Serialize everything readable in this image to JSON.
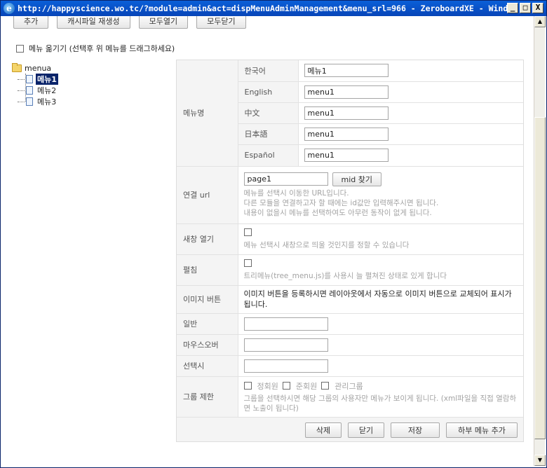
{
  "window": {
    "title": "http://happyscience.wo.tc/?module=admin&act=dispMenuAdminManagement&menu_srl=966 - ZeroboardXE - Windows Internet Explo...",
    "minimize": "_",
    "maximize": "□",
    "close": "X"
  },
  "toolbar": {
    "add": "추가",
    "regen_cache": "캐시파일 재생성",
    "expand_all": "모두열기",
    "collapse_all": "모두닫기"
  },
  "move_menu": {
    "label": "메뉴 옮기기 (선택후 위 메뉴를 드래그하세요)"
  },
  "tree": {
    "root": "menua",
    "items": [
      "메뉴1",
      "메뉴2",
      "메뉴3"
    ]
  },
  "form": {
    "menu_name": {
      "label": "메뉴명",
      "langs": [
        {
          "lang": "한국어",
          "value": "메뉴1"
        },
        {
          "lang": "English",
          "value": "menu1"
        },
        {
          "lang": "中文",
          "value": "menu1"
        },
        {
          "lang": "日本語",
          "value": "menu1"
        },
        {
          "lang": "Español",
          "value": "menu1"
        }
      ]
    },
    "url": {
      "label": "연결 url",
      "value": "page1",
      "mid_button": "mid 찾기",
      "desc1": "메뉴를 선택시 이동한 URL입니다.",
      "desc2": "다른 모듈을 연결하고자 할 때에는 id값만 입력해주시면 됩니다.",
      "desc3": "내용이 없을시 메뉴를 선택하여도 아무런 동작이 없게 됩니다."
    },
    "new_window": {
      "label": "새창 열기",
      "desc": "메뉴 선택시 새창으로 띄울 것인지를 정할 수 있습니다"
    },
    "expand": {
      "label": "펼침",
      "desc": "트리메뉴(tree_menu.js)를 사용시 늘 펼쳐진 상태로 있게 합니다"
    },
    "image_button": {
      "label": "이미지 버튼",
      "desc": "이미지 버튼을 등록하시면 레이아웃에서 자동으로 이미지 버튼으로 교체되어 표시가 됩니다."
    },
    "normal": {
      "label": "일반",
      "value": ""
    },
    "mouseover": {
      "label": "마우스오버",
      "value": ""
    },
    "selected": {
      "label": "선택시",
      "value": ""
    },
    "group_limit": {
      "label": "그룹 제한",
      "groups": [
        "정회원",
        "준회원",
        "관리그룹"
      ],
      "desc": "그룹을 선택하시면 해당 그룹의 사용자만 메뉴가 보이게 됩니다. (xml파일을 직접 열람하면 노출이 됩니다)"
    },
    "buttons": {
      "delete": "삭제",
      "close": "닫기",
      "save": "저장",
      "add_sub": "하부 메뉴 추가"
    }
  }
}
